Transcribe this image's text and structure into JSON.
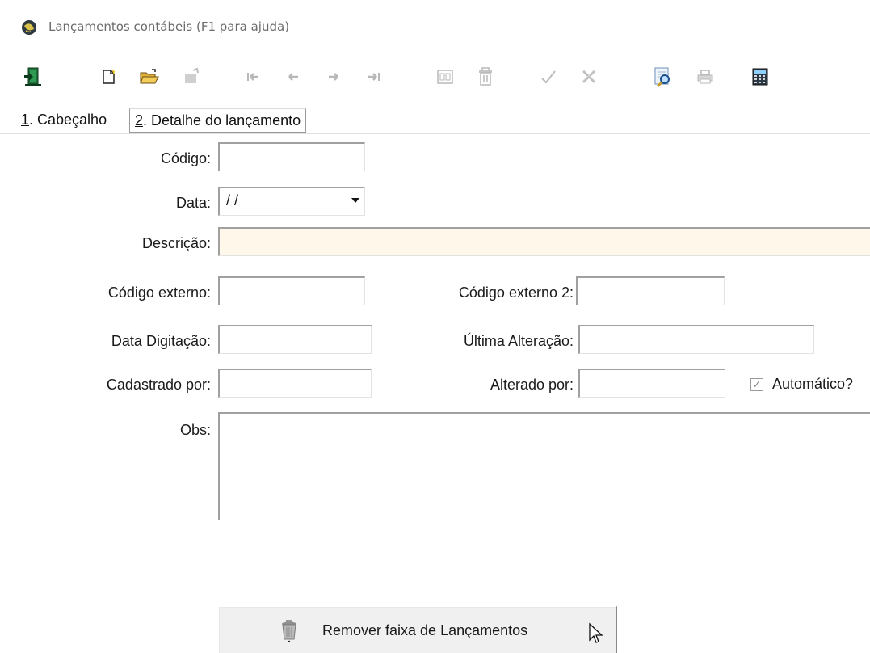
{
  "window": {
    "title": "Lançamentos contábeis (F1 para ajuda)",
    "icon": "globe-app-icon"
  },
  "toolbar": {
    "buttons": [
      {
        "name": "exit",
        "icon": "exit-door-icon",
        "enabled": true
      },
      {
        "name": "new",
        "icon": "new-document-icon",
        "enabled": true
      },
      {
        "name": "open",
        "icon": "open-folder-icon",
        "enabled": true
      },
      {
        "name": "edit",
        "icon": "edit-icon",
        "enabled": false
      },
      {
        "name": "first",
        "icon": "first-record-icon",
        "enabled": false
      },
      {
        "name": "prev",
        "icon": "prev-record-icon",
        "enabled": false
      },
      {
        "name": "next",
        "icon": "next-record-icon",
        "enabled": false
      },
      {
        "name": "last",
        "icon": "last-record-icon",
        "enabled": false
      },
      {
        "name": "form-view",
        "icon": "form-view-icon",
        "enabled": false
      },
      {
        "name": "delete",
        "icon": "trash-icon",
        "enabled": false
      },
      {
        "name": "confirm",
        "icon": "checkmark-icon",
        "enabled": false
      },
      {
        "name": "cancel",
        "icon": "cancel-x-icon",
        "enabled": false
      },
      {
        "name": "search",
        "icon": "search-magnifier-icon",
        "enabled": true
      },
      {
        "name": "print",
        "icon": "printer-icon",
        "enabled": false
      },
      {
        "name": "calculator",
        "icon": "calculator-icon",
        "enabled": true
      }
    ]
  },
  "tabs": [
    {
      "hotkey": "1",
      "label": ". Cabeçalho",
      "active": true
    },
    {
      "hotkey": "2",
      "label": ". Detalhe do lançamento",
      "active": false
    }
  ],
  "form": {
    "codigo": {
      "label": "Código:",
      "value": ""
    },
    "data": {
      "label": "Data:",
      "value": "/ /"
    },
    "descricao": {
      "label": "Descrição:",
      "value": ""
    },
    "codigo_externo": {
      "label": "Código externo:",
      "value": ""
    },
    "codigo_externo_2": {
      "label": "Código externo 2:",
      "value": ""
    },
    "data_digitacao": {
      "label": "Data Digitação:",
      "value": ""
    },
    "ultima_alteracao": {
      "label": "Última Alteração:",
      "value": ""
    },
    "cadastrado_por": {
      "label": "Cadastrado por:",
      "value": ""
    },
    "alterado_por": {
      "label": "Alterado por:",
      "value": ""
    },
    "automatico": {
      "label": "Automático?",
      "checked": true,
      "mark": "✓"
    },
    "obs": {
      "label": "Obs:",
      "value": ""
    }
  },
  "actions": {
    "remove_range": {
      "label": "Remover faixa de Lançamentos",
      "icon": "trash-can-icon"
    }
  },
  "colors": {
    "description_field_bg": "#fff8ea",
    "disabled_icon": "#b8b8b8"
  }
}
